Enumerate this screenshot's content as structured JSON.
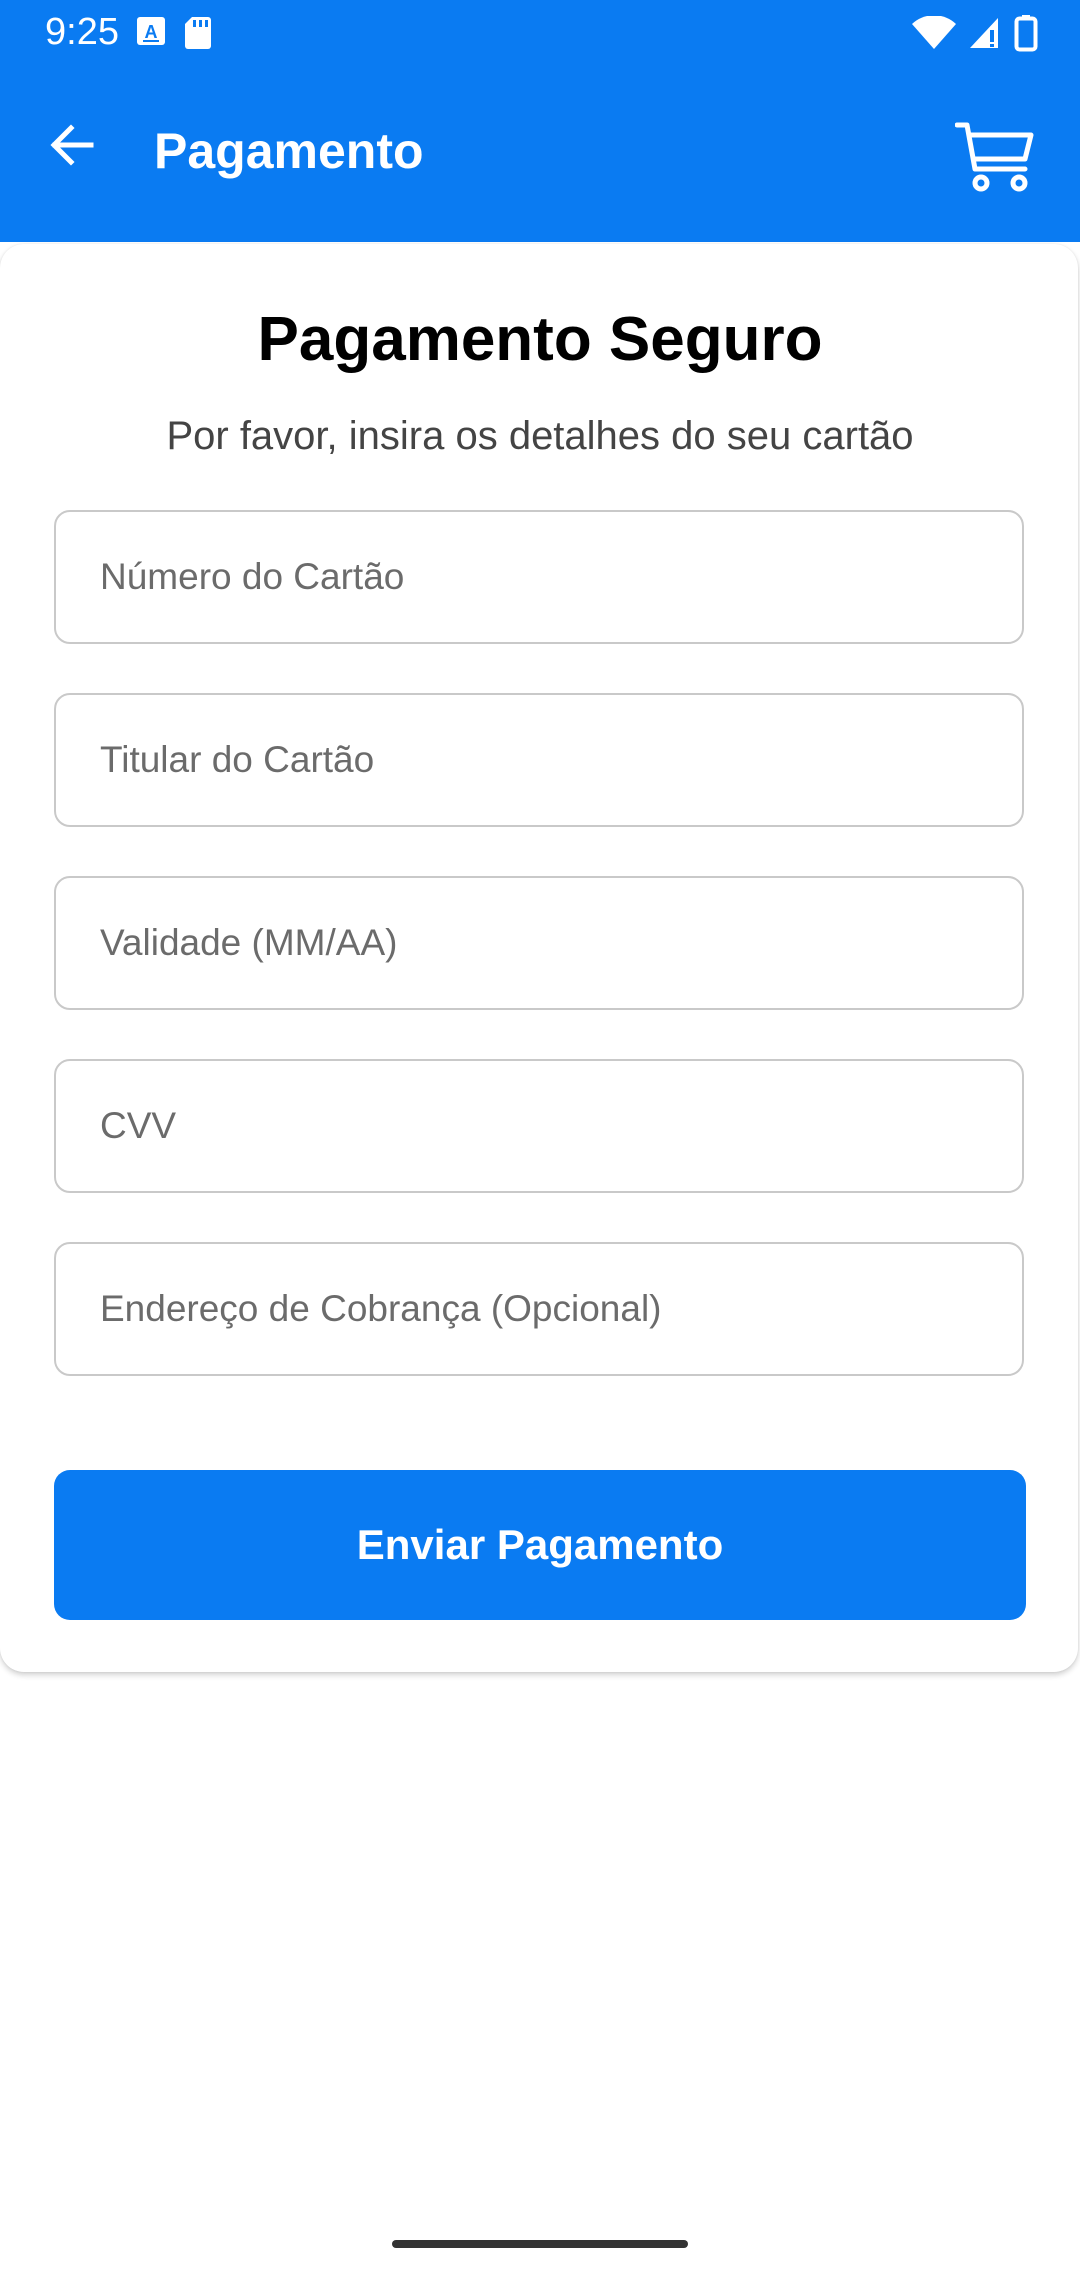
{
  "status_bar": {
    "time": "9:25",
    "icons": [
      "a-badge-icon",
      "sd-card-icon",
      "wifi-icon",
      "signal-icon",
      "battery-icon"
    ]
  },
  "app_bar": {
    "title": "Pagamento",
    "back_icon": "arrow-back-icon",
    "cart_icon": "shopping-cart-icon"
  },
  "form": {
    "title": "Pagamento Seguro",
    "subtitle": "Por favor, insira os detalhes do seu cartão",
    "fields": [
      {
        "placeholder": "Número do Cartão",
        "value": ""
      },
      {
        "placeholder": "Titular do Cartão",
        "value": ""
      },
      {
        "placeholder": "Validade (MM/AA)",
        "value": ""
      },
      {
        "placeholder": "CVV",
        "value": ""
      },
      {
        "placeholder": "Endereço de Cobrança (Opcional)",
        "value": ""
      }
    ],
    "submit_label": "Enviar Pagamento"
  },
  "colors": {
    "primary": "#0a7bf2",
    "on_primary": "#ffffff",
    "title_text": "#000000",
    "subtitle_text": "#444444",
    "placeholder_text": "#6b6b6b",
    "field_border": "#c9c9c9"
  }
}
